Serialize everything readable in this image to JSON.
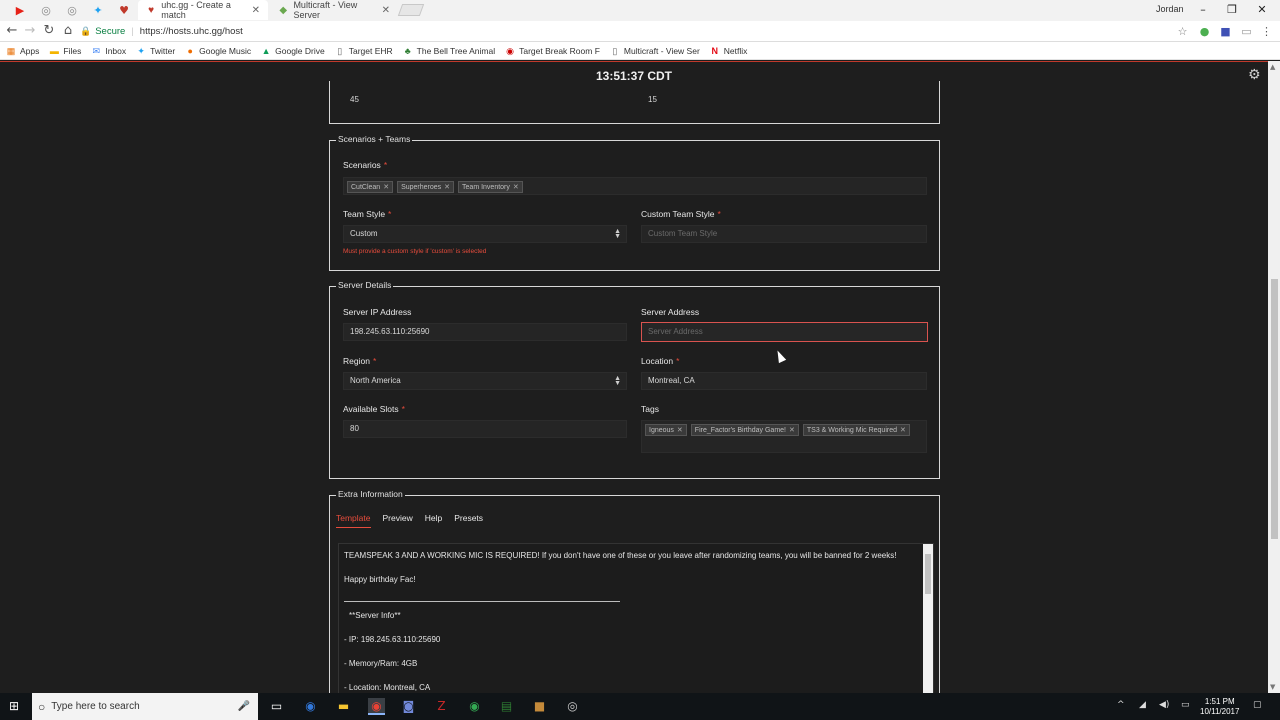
{
  "browser": {
    "tabs": [
      {
        "title": "uhc.gg - Create a match",
        "active": true
      },
      {
        "title": "Multicraft - View Server",
        "active": false
      }
    ],
    "user": "Jordan",
    "address": {
      "secure_label": "Secure",
      "url": "https://hosts.uhc.gg/host"
    },
    "bookmarks": [
      "Apps",
      "Files",
      "Inbox",
      "Twitter",
      "Google Music",
      "Google Drive",
      "Target EHR",
      "The Bell Tree Animal",
      "Target Break Room F",
      "Multicraft - View Ser",
      "Netflix"
    ]
  },
  "header": {
    "clock": "13:51:37 CDT"
  },
  "top_partial": {
    "left_value": "45",
    "right_value": "15"
  },
  "scenarios_teams": {
    "legend": "Scenarios + Teams",
    "scenarios_label": "Scenarios",
    "scenarios": [
      "CutClean",
      "Superheroes",
      "Team Inventory"
    ],
    "team_style_label": "Team Style",
    "team_style_value": "Custom",
    "custom_team_style_label": "Custom Team Style",
    "custom_team_style_placeholder": "Custom Team Style",
    "error": "Must provide a custom style if 'custom' is selected"
  },
  "server_details": {
    "legend": "Server Details",
    "ip_label": "Server IP Address",
    "ip_value": "198.245.63.110:25690",
    "address_label": "Server Address",
    "address_placeholder": "Server Address",
    "region_label": "Region",
    "region_value": "North America",
    "location_label": "Location",
    "location_value": "Montreal, CA",
    "slots_label": "Available Slots",
    "slots_value": "80",
    "tags_label": "Tags",
    "tags": [
      "Igneous",
      "Fire_Factor's Birthday Game!",
      "TS3 & Working Mic Required"
    ]
  },
  "extra": {
    "legend": "Extra Information",
    "tabs": [
      "Template",
      "Preview",
      "Help",
      "Presets"
    ],
    "lines": [
      "TEAMSPEAK 3 AND A WORKING MIC IS REQUIRED! If you don't have one of these or you leave after randomizing teams, you will be banned for 2 weeks!",
      "Happy birthday Fac!",
      "**Server Info**",
      "- IP: 198.245.63.110:25690",
      "- Memory/Ram: 4GB",
      "- Location: Montreal, CA"
    ]
  },
  "taskbar": {
    "search_placeholder": "Type here to search",
    "time": "1:51 PM",
    "date": "10/11/2017"
  }
}
